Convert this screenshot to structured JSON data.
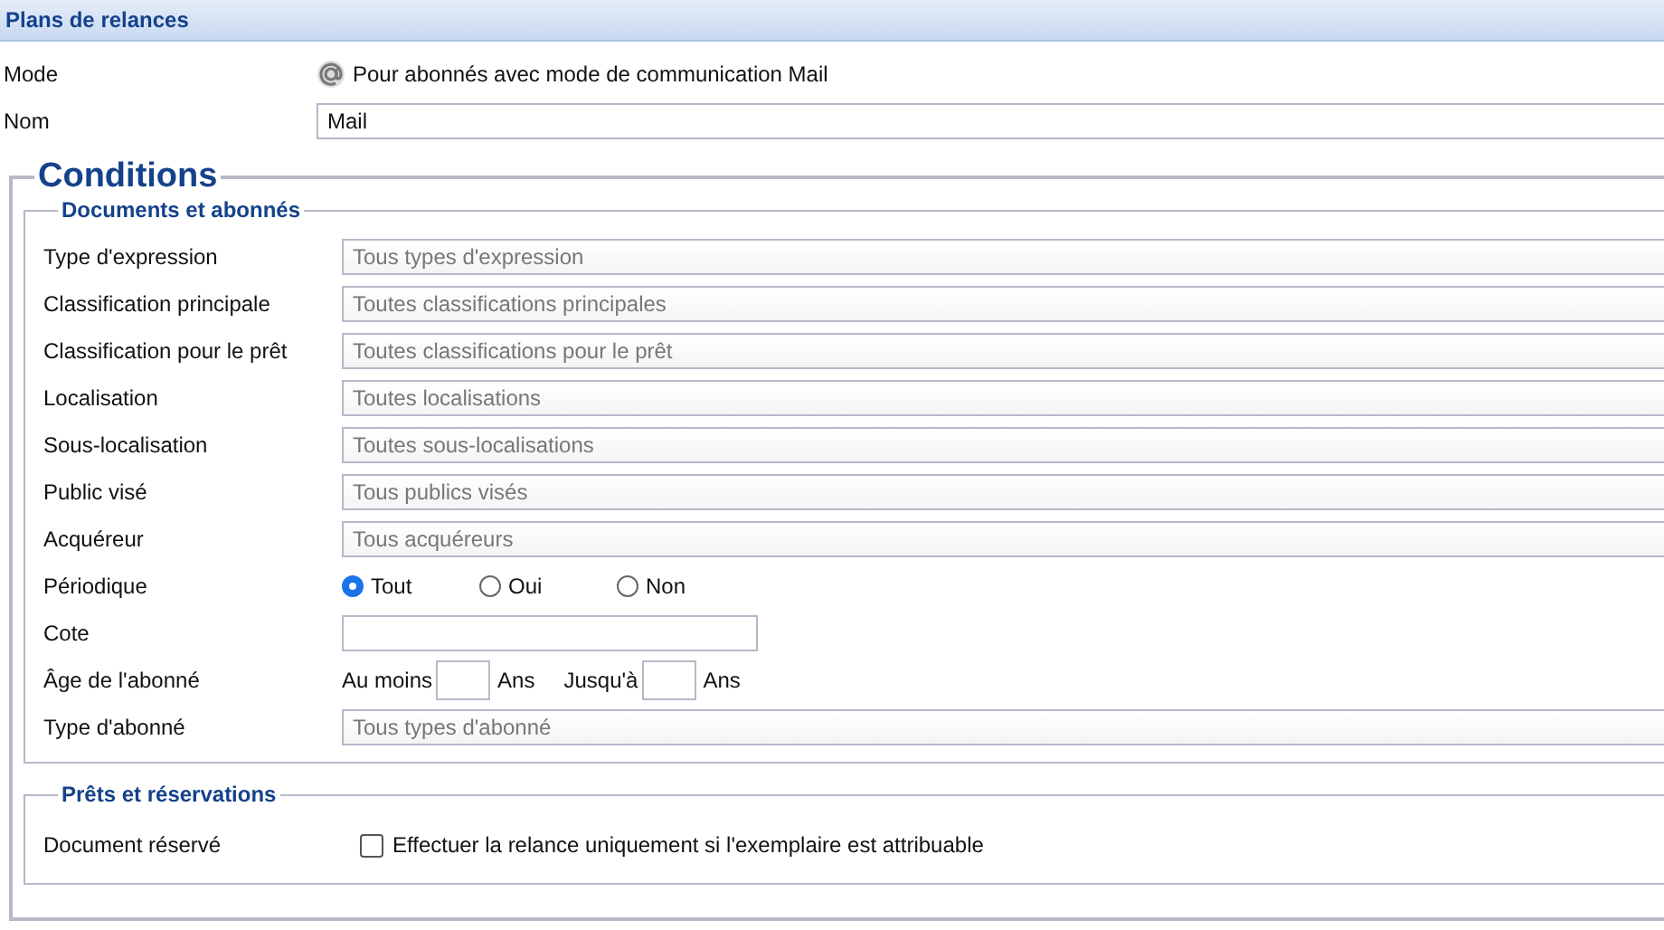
{
  "panel": {
    "title": "Plans de relances"
  },
  "mode": {
    "label": "Mode",
    "text": "Pour abonnés avec mode de communication Mail"
  },
  "nom": {
    "label": "Nom",
    "value": "Mail"
  },
  "conditions": {
    "legend": "Conditions",
    "sections": [
      {
        "legend": "Documents et abonnés",
        "rows": [
          {
            "kind": "select",
            "label": "Type d'expression",
            "placeholder": "Tous types d'expression"
          },
          {
            "kind": "select",
            "label": "Classification principale",
            "placeholder": "Toutes classifications principales"
          },
          {
            "kind": "select",
            "label": "Classification pour le prêt",
            "placeholder": "Toutes classifications pour le prêt"
          },
          {
            "kind": "select",
            "label": "Localisation",
            "placeholder": "Toutes localisations"
          },
          {
            "kind": "select",
            "label": "Sous-localisation",
            "placeholder": "Toutes sous-localisations"
          },
          {
            "kind": "select",
            "label": "Public visé",
            "placeholder": "Tous publics visés"
          },
          {
            "kind": "select",
            "label": "Acquéreur",
            "placeholder": "Tous acquéreurs"
          },
          {
            "kind": "radio",
            "label": "Périodique",
            "options": [
              {
                "label": "Tout",
                "selected": true
              },
              {
                "label": "Oui",
                "selected": false
              },
              {
                "label": "Non",
                "selected": false
              }
            ]
          },
          {
            "kind": "text",
            "label": "Cote"
          },
          {
            "kind": "range",
            "label": "Âge de l'abonné",
            "from_label": "Au moins",
            "from_unit": "Ans",
            "to_label": "Jusqu'à",
            "to_unit": "Ans"
          },
          {
            "kind": "select",
            "label": "Type d'abonné",
            "placeholder": "Tous types d'abonné"
          }
        ]
      },
      {
        "legend": "Prêts et réservations",
        "rows": [
          {
            "kind": "checkbox",
            "label": "Document réservé",
            "text": "Effectuer la relance uniquement si l'exemplaire est attribuable",
            "checked": false
          }
        ]
      }
    ]
  }
}
